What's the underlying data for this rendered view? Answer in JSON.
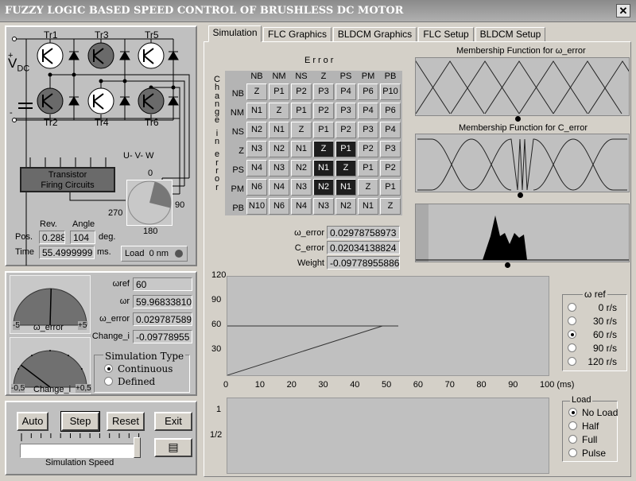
{
  "window": {
    "title": "FUZZY LOGIC BASED SPEED CONTROL OF BRUSHLESS DC MOTOR",
    "close": "✕"
  },
  "circuit": {
    "transistors": [
      {
        "label": "Tr1",
        "on": false
      },
      {
        "label": "Tr3",
        "on": true
      },
      {
        "label": "Tr5",
        "on": false
      },
      {
        "label": "Tr2",
        "on": true
      },
      {
        "label": "Tr4",
        "on": false
      },
      {
        "label": "Tr6",
        "on": true
      }
    ],
    "vdc": "V",
    "vdc_sub": "DC",
    "plus": "+",
    "minus": "-",
    "uvw": "U- V- W",
    "firing": [
      "Transistor",
      "Firing Circuits"
    ],
    "angle_labels": {
      "a0": "0",
      "a90": "90",
      "a180": "180",
      "a270": "270"
    },
    "rotor_angle_deg": 104
  },
  "position": {
    "rev_label": "Rev.",
    "angle_label": "Angle",
    "pos_label": "Pos.",
    "rev": "0.288",
    "angle": "104",
    "deg": "deg.",
    "time_label": "Time",
    "time": "55.4999999",
    "ms": "ms.",
    "load_label": "Load",
    "load_value": "0 nm"
  },
  "gauges": {
    "error": {
      "min": "-5",
      "max": "+5",
      "label": "ω_error",
      "value": 0.0298
    },
    "change": {
      "min": "-0,5",
      "max": "+0,5",
      "label": "Change_i",
      "value": -0.0978
    }
  },
  "readouts": [
    {
      "label": "ωref",
      "value": "60"
    },
    {
      "label": "ωr",
      "value": "59.96833810"
    },
    {
      "label": "ω_error",
      "value": "0.029787589"
    },
    {
      "label": "Change_i",
      "value": "-0.09778955"
    }
  ],
  "sim_type": {
    "title": "Simulation Type",
    "options": [
      "Continuous",
      "Defined"
    ],
    "selected": 0
  },
  "controls": {
    "auto": "Auto",
    "step": "Step",
    "reset": "Reset",
    "exit": "Exit",
    "speed_label": "Simulation Speed"
  },
  "tabs": [
    "Simulation",
    "FLC Graphics",
    "BLDCM Graphics",
    "FLC Setup",
    "BLDCM Setup"
  ],
  "active_tab": 0,
  "rules": {
    "title": "Error",
    "side_title": "Change in error",
    "cols": [
      "NB",
      "NM",
      "NS",
      "Z",
      "PS",
      "PM",
      "PB"
    ],
    "rows": [
      "NB",
      "NM",
      "NS",
      "Z",
      "PS",
      "PM",
      "PB"
    ],
    "cells": [
      [
        "Z",
        "P1",
        "P2",
        "P3",
        "P4",
        "P6",
        "P10"
      ],
      [
        "N1",
        "Z",
        "P1",
        "P2",
        "P3",
        "P4",
        "P6"
      ],
      [
        "N2",
        "N1",
        "Z",
        "P1",
        "P2",
        "P3",
        "P4"
      ],
      [
        "N3",
        "N2",
        "N1",
        "Z",
        "P1",
        "P2",
        "P3"
      ],
      [
        "N4",
        "N3",
        "N2",
        "N1",
        "Z",
        "P1",
        "P2"
      ],
      [
        "N6",
        "N4",
        "N3",
        "N2",
        "N1",
        "Z",
        "P1"
      ],
      [
        "N10",
        "N6",
        "N4",
        "N3",
        "N2",
        "N1",
        "Z"
      ]
    ],
    "active": [
      [
        3,
        3
      ],
      [
        3,
        4
      ],
      [
        4,
        3
      ],
      [
        4,
        4
      ],
      [
        5,
        3
      ],
      [
        5,
        4
      ]
    ]
  },
  "fuzzy_out": [
    {
      "label": "ω_error",
      "value": "0.02978758973"
    },
    {
      "label": "C_error",
      "value": "0.02034138824"
    },
    {
      "label": "Weight",
      "value": "-0.09778955886"
    }
  ],
  "membership": {
    "error_title": "Membership Function for ω_error",
    "cerror_title": "Membership Function for C_error"
  },
  "chart_data": [
    {
      "type": "line",
      "yticks": [
        "120",
        "90",
        "60",
        "30"
      ],
      "ylim": [
        0,
        120
      ],
      "xticks": [
        "0",
        "10",
        "20",
        "30",
        "40",
        "50",
        "60",
        "70",
        "80",
        "90",
        "100 (ms)"
      ],
      "xlim": [
        0,
        100
      ],
      "series": [
        {
          "x": [
            0,
            54
          ],
          "y": [
            60,
            60
          ]
        },
        {
          "x": [
            0,
            49,
            54
          ],
          "y": [
            0,
            60,
            60
          ]
        }
      ]
    },
    {
      "type": "line",
      "yticks": [
        "1",
        "1/2"
      ],
      "series": []
    }
  ],
  "wref": {
    "title": "ω ref",
    "options": [
      "0 r/s",
      "30 r/s",
      "60 r/s",
      "90 r/s",
      "120 r/s"
    ],
    "selected": 2
  },
  "load": {
    "title": "Load",
    "options": [
      "No Load",
      "Half",
      "Full",
      "Pulse"
    ],
    "selected": 0
  }
}
